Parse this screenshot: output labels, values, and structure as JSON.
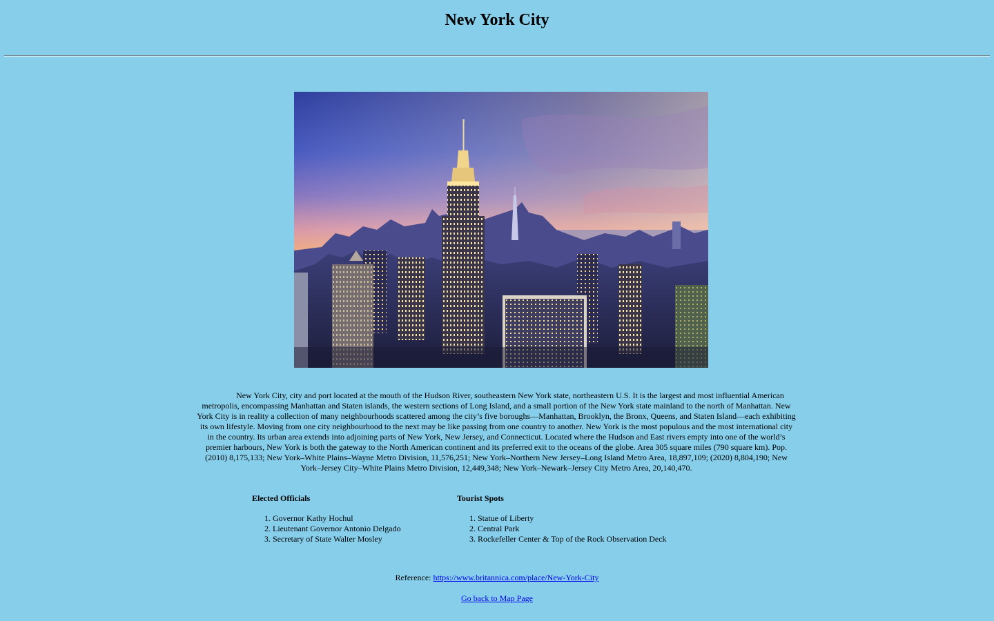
{
  "page": {
    "title": "New York City"
  },
  "hero_image": {
    "alt": "New York City skyline at sunset with the Empire State Building"
  },
  "description": "New York City, city and port located at the mouth of the Hudson River, southeastern New York state, northeastern U.S. It is the largest and most influential American metropolis, encompassing Manhattan and Staten islands, the western sections of Long Island, and a small portion of the New York state mainland to the north of Manhattan. New York City is in reality a collection of many neighbourhoods scattered among the city’s five boroughs—Manhattan, Brooklyn, the Bronx, Queens, and Staten Island—each exhibiting its own lifestyle. Moving from one city neighbourhood to the next may be like passing from one country to another. New York is the most populous and the most international city in the country. Its urban area extends into adjoining parts of New York, New Jersey, and Connecticut. Located where the Hudson and East rivers empty into one of the world’s premier harbours, New York is both the gateway to the North American continent and its preferred exit to the oceans of the globe. Area 305 square miles (790 square km). Pop. (2010) 8,175,133; New York–White Plains–Wayne Metro Division, 11,576,251; New York–Northern New Jersey–Long Island Metro Area, 18,897,109; (2020) 8,804,190; New York–Jersey City–White Plains Metro Division, 12,449,348; New York–Newark–Jersey City Metro Area, 20,140,470.",
  "officials": {
    "heading": "Elected Officials",
    "items": [
      "Governor Kathy Hochul",
      "Lieutenant Governor Antonio Delgado",
      "Secretary of State Walter Mosley"
    ]
  },
  "spots": {
    "heading": "Tourist Spots",
    "items": [
      "Statue of Liberty",
      "Central Park",
      "Rockefeller Center & Top of the Rock Observation Deck"
    ]
  },
  "reference": {
    "label": "Reference: ",
    "link_text": "https://www.britannica.com/place/New-York-City",
    "href": "https://www.britannica.com/place/New-York-City"
  },
  "back_link": {
    "text": "Go back to Map Page"
  },
  "colors": {
    "background": "#87ceeb",
    "link": "#0000ee"
  }
}
